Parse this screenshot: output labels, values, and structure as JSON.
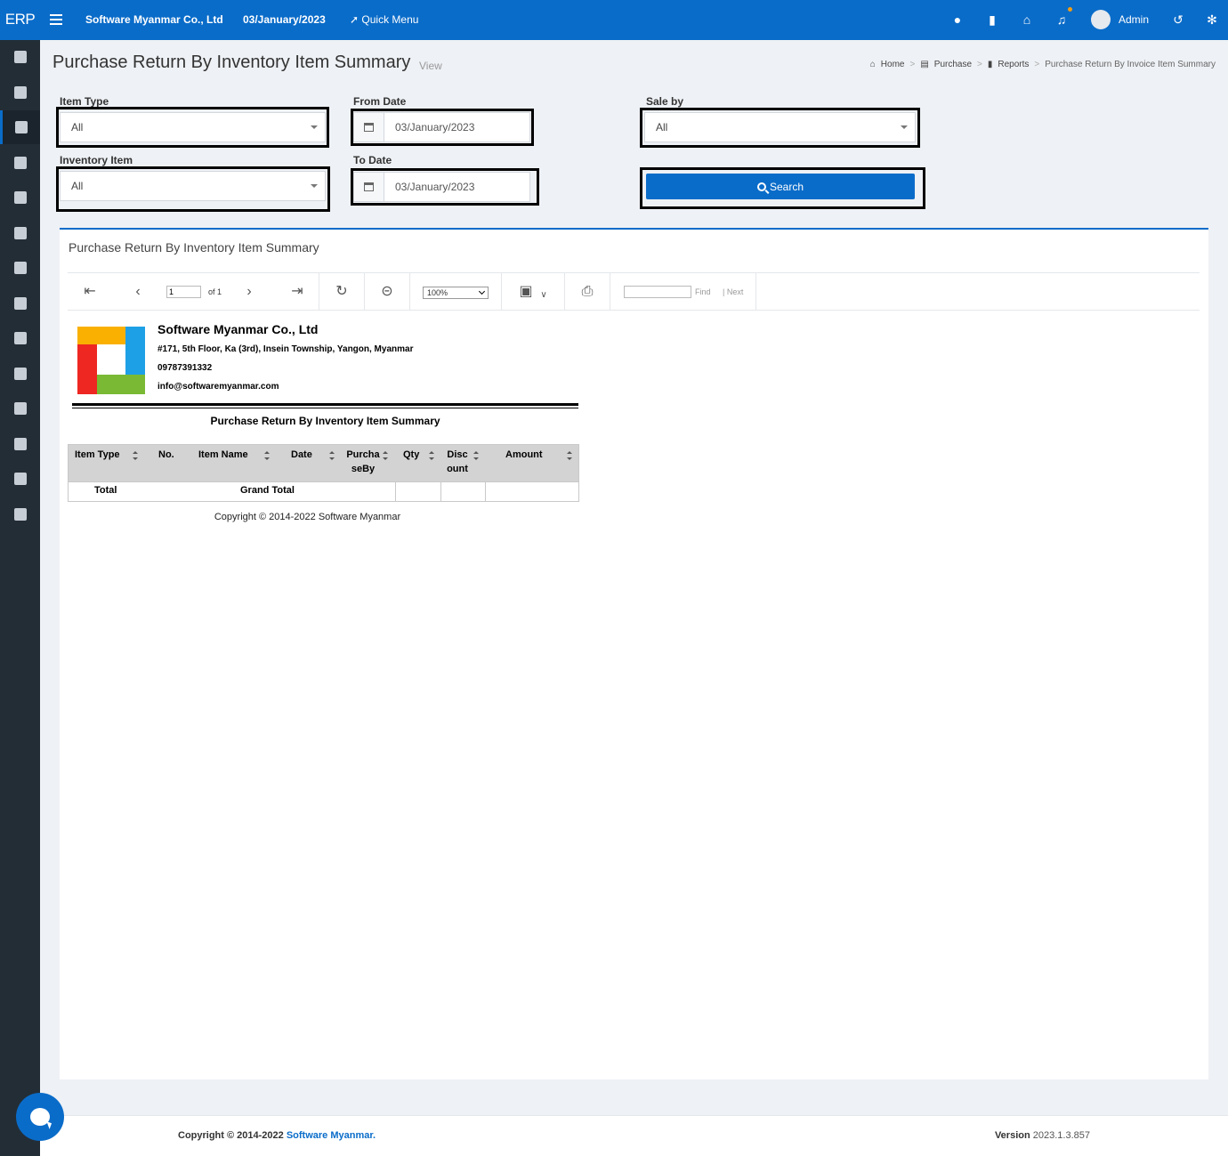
{
  "header": {
    "brand": "ERP",
    "company": "Software Myanmar Co., Ltd",
    "date": "03/January/2023",
    "quick_menu": "Quick Menu",
    "user": "Admin"
  },
  "page": {
    "title": "Purchase Return By Inventory Item Summary",
    "subtitle": "View"
  },
  "breadcrumb": [
    "Home",
    "Purchase",
    "Reports",
    "Purchase Return By Invoice Item Summary"
  ],
  "filters": {
    "item_type_label": "Item Type",
    "item_type_value": "All",
    "from_date_label": "From Date",
    "from_date_value": "03/January/2023",
    "sale_by_label": "Sale by",
    "sale_by_value": "All",
    "inventory_item_label": "Inventory Item",
    "inventory_item_value": "All",
    "to_date_label": "To Date",
    "to_date_value": "03/January/2023",
    "search_label": "Search"
  },
  "panel": {
    "title": "Purchase Return By Inventory Item Summary"
  },
  "toolbar": {
    "page_value": "1",
    "of_text": "of 1",
    "zoom": "100%",
    "find": "Find",
    "next": "Next"
  },
  "report": {
    "company": "Software Myanmar Co., Ltd",
    "address": "#171, 5th Floor, Ka (3rd), Insein Township, Yangon, Myanmar",
    "phone": "09787391332",
    "email": "info@softwaremyanmar.com",
    "title": "Purchase Return By Inventory Item Summary",
    "columns": {
      "item_type": "Item Type",
      "no": "No.",
      "item_name": "Item Name",
      "date": "Date",
      "purchase_by_1": "Purcha",
      "purchase_by_2": "seBy",
      "qty": "Qty",
      "discount_1": "Disc",
      "discount_2": "ount",
      "amount": "Amount"
    },
    "total_label": "Total",
    "grand_total_label": "Grand Total",
    "copyright": "Copyright © 2014-2022 Software Myanmar"
  },
  "footer": {
    "copyright_prefix": "Copyright © 2014-2022",
    "copyright_link": "Software Myanmar.",
    "version_label": "Version",
    "version_value": "2023.1.3.857"
  },
  "colors": {
    "primary": "#0a6cc9",
    "sidebar": "#232d36"
  }
}
